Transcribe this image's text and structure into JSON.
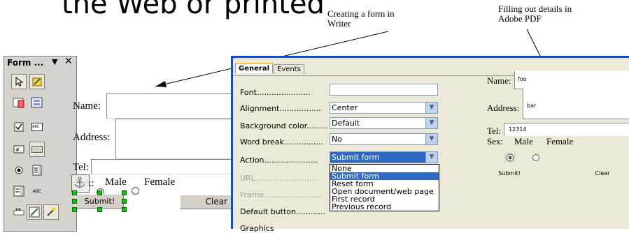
{
  "heading": "the Web or printed",
  "captions": {
    "writer": "Creating a form in\nWriter",
    "pdf": "Filling out details in\nAdobe PDF"
  },
  "toolbar": {
    "title": "Form ...",
    "menu_arrow": "▼",
    "close": "✕",
    "icons": [
      "select-icon",
      "design-mode-icon",
      "control-properties-icon",
      "form-properties-icon",
      "checkbox-icon",
      "text-field-icon",
      "formatted-field-icon",
      "push-button-icon",
      "option-button-icon",
      "list-box-icon",
      "combo-box-icon",
      "label-field-icon",
      "more-controls-icon",
      "form-design-icon",
      "wizards-icon"
    ],
    "abc1": "ABC",
    "abc2": "ABC"
  },
  "writer_form": {
    "name_label": "Name:",
    "address_label": "Address:",
    "tel_label": "Tel:",
    "sex_label": "Sex:",
    "male": "Male",
    "female": "Female",
    "submit": "Submit!",
    "clear": "Clear"
  },
  "properties": {
    "tabs": [
      "General",
      "Events"
    ],
    "rows": [
      {
        "label": "Font......................",
        "value": ""
      },
      {
        "label": "Alignment.................",
        "value": "Center"
      },
      {
        "label": "Background color.........",
        "value": "Default"
      },
      {
        "label": "Word break................",
        "value": "No"
      },
      {
        "label": "Action......................",
        "value": "Submit form"
      },
      {
        "label": "URL..........................",
        "value": ""
      },
      {
        "label": "Frame........................",
        "value": ""
      },
      {
        "label": "Default button............",
        "value": ""
      },
      {
        "label": "Graphics",
        "value": ""
      }
    ],
    "action_options": [
      "None",
      "Submit form",
      "Reset form",
      "Open document/web page",
      "First record",
      "Previous record"
    ]
  },
  "pdf_form": {
    "name_label": "Name:",
    "name_value": "foo",
    "address_label": "Address:",
    "address_value": "bar",
    "tel_label": "Tel:",
    "tel_value": "12314",
    "sex_label": "Sex:",
    "male": "Male",
    "female": "Female",
    "submit": "Submit!",
    "clear": "Clear"
  }
}
